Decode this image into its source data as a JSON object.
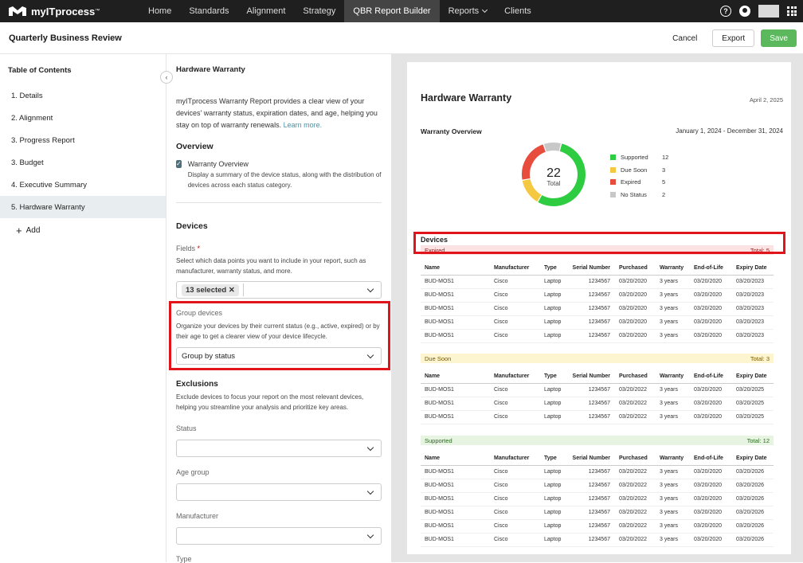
{
  "topbar": {
    "brand": "myITprocess",
    "brand_tm": "™",
    "nav": [
      "Home",
      "Standards",
      "Alignment",
      "Strategy",
      "QBR Report Builder",
      "Reports",
      "Clients"
    ],
    "active_nav": "QBR Report Builder",
    "help_icon": "?"
  },
  "header": {
    "title": "Quarterly Business Review",
    "cancel": "Cancel",
    "export": "Export",
    "save": "Save"
  },
  "toc": {
    "title": "Table of Contents",
    "items": [
      "1. Details",
      "2. Alignment",
      "3. Progress Report",
      "3. Budget",
      "4. Executive Summary",
      "5. Hardware Warranty"
    ],
    "add": "Add"
  },
  "settings": {
    "section_title": "Hardware Warranty",
    "intro": "myITprocess Warranty Report provides a clear view of your devices' warranty status, expiration dates, and age, helping you stay on top of warranty renewals.",
    "learn_more": "Learn more.",
    "overview_heading": "Overview",
    "overview_checkbox_label": "Warranty Overview",
    "overview_checkbox_desc": "Display a summary of the device status, along with the distribution of devices across each status category.",
    "devices_heading": "Devices",
    "fields_label": "Fields",
    "fields_required": "*",
    "fields_desc": "Select which data points you want to include in your report, such as manufacturer, warranty status, and more.",
    "fields_value": "13 selected",
    "group_label": "Group devices",
    "group_desc": "Organize your devices by their current status (e.g., active, expired) or by their age to get a clearer view of your device lifecycle.",
    "group_value": "Group by status",
    "exclusions_heading": "Exclusions",
    "exclusions_desc": "Exclude devices to focus your report on the most relevant devices, helping you streamline your analysis and prioritize key areas.",
    "status_label": "Status",
    "age_label": "Age group",
    "manufacturer_label": "Manufacturer",
    "type_label": "Type"
  },
  "preview": {
    "title": "Hardware Warranty",
    "date": "April 2, 2025",
    "overview_title": "Warranty Overview",
    "range": "January 1, 2024 - December 31, 2024",
    "total_value": "22",
    "total_label": "Total",
    "legend": [
      {
        "name": "Supported",
        "value": 12,
        "color": "#2ecc40"
      },
      {
        "name": "Due Soon",
        "value": 3,
        "color": "#f5c842"
      },
      {
        "name": "Expired",
        "value": 5,
        "color": "#e84c3d"
      },
      {
        "name": "No Status",
        "value": 2,
        "color": "#c8c8c8"
      }
    ],
    "devices_title": "Devices",
    "columns": [
      "Name",
      "Manufacturer",
      "Type",
      "Serial Number",
      "Purchased",
      "Warranty",
      "End-of-Life",
      "Expiry Date"
    ],
    "groups": {
      "expired": {
        "label": "Expired",
        "total": "Total: 5",
        "rows": [
          [
            "BUD-MOS1",
            "Cisco",
            "Laptop",
            "1234567",
            "03/20/2020",
            "3 years",
            "03/20/2020",
            "03/20/2023"
          ],
          [
            "BUD-MOS1",
            "Cisco",
            "Laptop",
            "1234567",
            "03/20/2020",
            "3 years",
            "03/20/2020",
            "03/20/2023"
          ],
          [
            "BUD-MOS1",
            "Cisco",
            "Laptop",
            "1234567",
            "03/20/2020",
            "3 years",
            "03/20/2020",
            "03/20/2023"
          ],
          [
            "BUD-MOS1",
            "Cisco",
            "Laptop",
            "1234567",
            "03/20/2020",
            "3 years",
            "03/20/2020",
            "03/20/2023"
          ],
          [
            "BUD-MOS1",
            "Cisco",
            "Laptop",
            "1234567",
            "03/20/2020",
            "3 years",
            "03/20/2020",
            "03/20/2023"
          ]
        ]
      },
      "due": {
        "label": "Due Soon",
        "total": "Total: 3",
        "rows": [
          [
            "BUD-MOS1",
            "Cisco",
            "Laptop",
            "1234567",
            "03/20/2022",
            "3 years",
            "03/20/2020",
            "03/20/2025"
          ],
          [
            "BUD-MOS1",
            "Cisco",
            "Laptop",
            "1234567",
            "03/20/2022",
            "3 years",
            "03/20/2020",
            "03/20/2025"
          ],
          [
            "BUD-MOS1",
            "Cisco",
            "Laptop",
            "1234567",
            "03/20/2022",
            "3 years",
            "03/20/2020",
            "03/20/2025"
          ]
        ]
      },
      "supported": {
        "label": "Supported",
        "total": "Total: 12",
        "rows": [
          [
            "BUD-MOS1",
            "Cisco",
            "Laptop",
            "1234567",
            "03/20/2022",
            "3 years",
            "03/20/2020",
            "03/20/2026"
          ],
          [
            "BUD-MOS1",
            "Cisco",
            "Laptop",
            "1234567",
            "03/20/2022",
            "3 years",
            "03/20/2020",
            "03/20/2026"
          ],
          [
            "BUD-MOS1",
            "Cisco",
            "Laptop",
            "1234567",
            "03/20/2022",
            "3 years",
            "03/20/2020",
            "03/20/2026"
          ],
          [
            "BUD-MOS1",
            "Cisco",
            "Laptop",
            "1234567",
            "03/20/2022",
            "3 years",
            "03/20/2020",
            "03/20/2026"
          ],
          [
            "BUD-MOS1",
            "Cisco",
            "Laptop",
            "1234567",
            "03/20/2022",
            "3 years",
            "03/20/2020",
            "03/20/2026"
          ],
          [
            "BUD-MOS1",
            "Cisco",
            "Laptop",
            "1234567",
            "03/20/2022",
            "3 years",
            "03/20/2020",
            "03/20/2026"
          ]
        ]
      }
    }
  }
}
